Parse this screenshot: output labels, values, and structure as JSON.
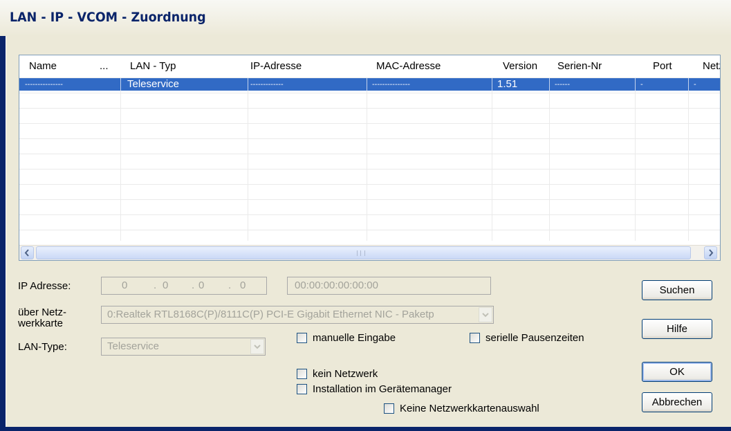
{
  "window": {
    "title": "LAN - IP - VCOM - Zuordnung"
  },
  "table": {
    "columns": [
      "Name",
      "...",
      "LAN - Typ",
      "IP-Adresse",
      "MAC-Adresse",
      "Version",
      "Serien-Nr",
      "Port",
      "Netz"
    ],
    "rows": [
      [
        "---------------",
        "Teleservice",
        "-------------",
        "---------------",
        "1.51",
        "------",
        "-",
        "-"
      ]
    ]
  },
  "form": {
    "ip_label": "IP Adresse:",
    "ip_octets": [
      "0",
      "0",
      "0",
      "0"
    ],
    "mac_value": "00:00:00:00:00:00",
    "nic_label_line1": "über Netz-",
    "nic_label_line2": "werkkarte",
    "nic_value": "0:Realtek RTL8168C(P)/8111C(P) PCI-E Gigabit Ethernet NIC - Paketp",
    "lantype_label": "LAN-Type:",
    "lantype_value": "Teleservice"
  },
  "checkboxes": {
    "manual": "manuelle Eingabe",
    "serial_pause": "serielle Pausenzeiten",
    "no_network": "kein Netzwerk",
    "device_manager": "Installation im Gerätemanager",
    "no_nic_select": "Keine Netzwerkkartenauswahl"
  },
  "buttons": {
    "search": "Suchen",
    "help": "Hilfe",
    "ok": "OK",
    "cancel": "Abbrechen"
  },
  "icons": {
    "scroll_left": "chevron-left-icon",
    "scroll_right": "chevron-right-icon",
    "combo_arrow": "chevron-down-icon"
  }
}
